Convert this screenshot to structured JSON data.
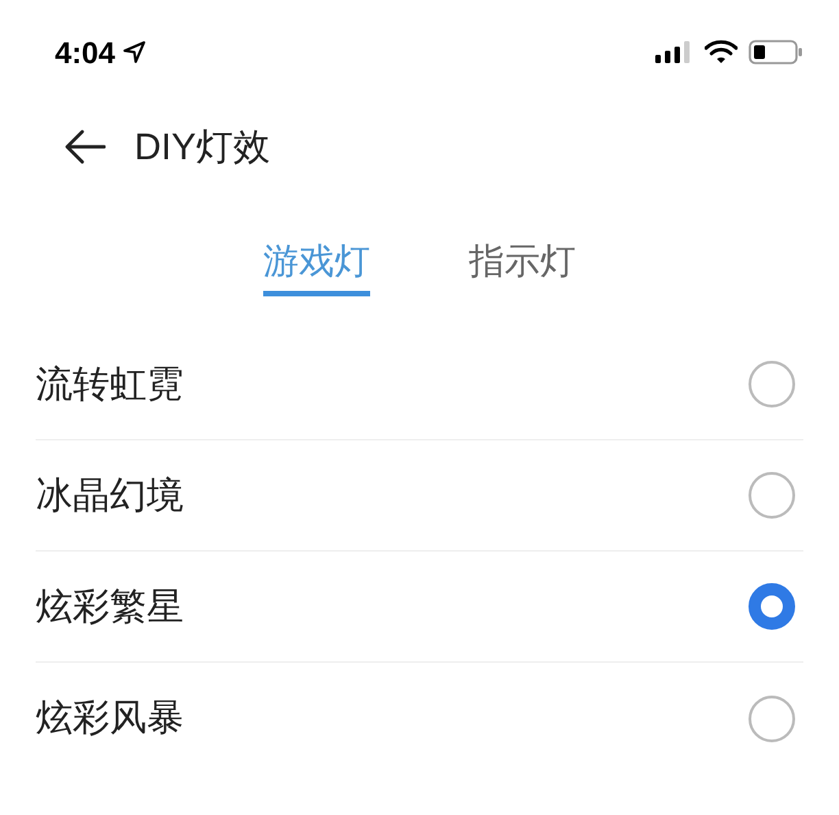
{
  "status_bar": {
    "time": "4:04"
  },
  "header": {
    "title": "DIY灯效"
  },
  "tabs": [
    {
      "label": "游戏灯",
      "selected": true
    },
    {
      "label": "指示灯",
      "selected": false
    }
  ],
  "options": [
    {
      "label": "流转虹霓",
      "selected": false
    },
    {
      "label": "冰晶幻境",
      "selected": false
    },
    {
      "label": "炫彩繁星",
      "selected": true
    },
    {
      "label": "炫彩风暴",
      "selected": false
    }
  ]
}
